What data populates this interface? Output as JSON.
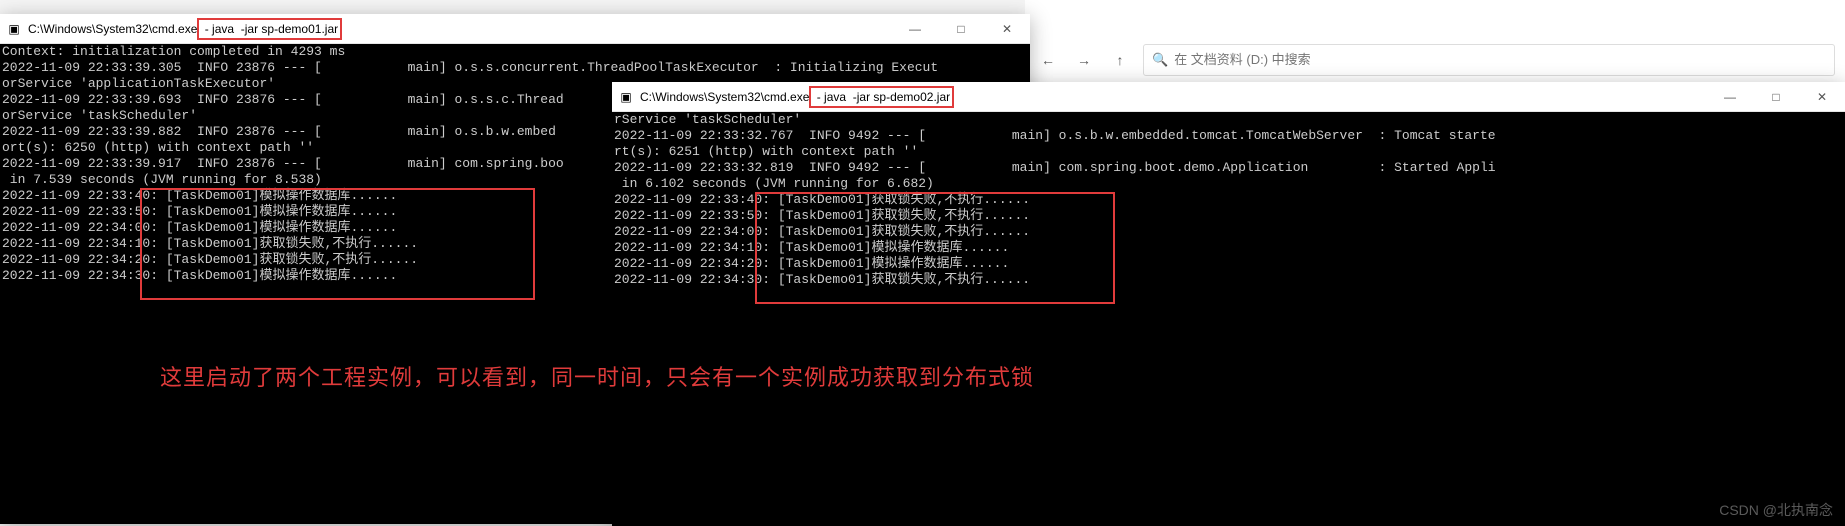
{
  "explorer": {
    "search_placeholder": "在 文档资料 (D:) 中搜索"
  },
  "win1": {
    "title_path": "C:\\Windows\\System32\\cmd.exe",
    "title_cmd": " - java  -jar sp-demo01.jar",
    "lines": [
      "Context: initialization completed in 4293 ms",
      "2022-11-09 22:33:39.305  INFO 23876 --- [           main] o.s.s.concurrent.ThreadPoolTaskExecutor  : Initializing Execut",
      "orService 'applicationTaskExecutor'",
      "2022-11-09 22:33:39.693  INFO 23876 --- [           main] o.s.s.c.Thread",
      "orService 'taskScheduler'",
      "2022-11-09 22:33:39.882  INFO 23876 --- [           main] o.s.b.w.embed",
      "ort(s): 6250 (http) with context path ''",
      "2022-11-09 22:33:39.917  INFO 23876 --- [           main] com.spring.boo",
      " in 7.539 seconds (JVM running for 8.538)"
    ],
    "tasks": [
      "2022-11-09 22:33:40: [TaskDemo01]模拟操作数据库......",
      "2022-11-09 22:33:50: [TaskDemo01]模拟操作数据库......",
      "2022-11-09 22:34:00: [TaskDemo01]模拟操作数据库......",
      "2022-11-09 22:34:10: [TaskDemo01]获取锁失败,不执行......",
      "2022-11-09 22:34:20: [TaskDemo01]获取锁失败,不执行......",
      "2022-11-09 22:34:30: [TaskDemo01]模拟操作数据库......"
    ]
  },
  "win2": {
    "title_path": "C:\\Windows\\System32\\cmd.exe",
    "title_cmd": " - java  -jar sp-demo02.jar",
    "lines": [
      "rService 'taskScheduler'",
      "2022-11-09 22:33:32.767  INFO 9492 --- [           main] o.s.b.w.embedded.tomcat.TomcatWebServer  : Tomcat starte",
      "rt(s): 6251 (http) with context path ''",
      "2022-11-09 22:33:32.819  INFO 9492 --- [           main] com.spring.boot.demo.Application         : Started Appli",
      " in 6.102 seconds (JVM running for 6.682)"
    ],
    "tasks": [
      "2022-11-09 22:33:40: [TaskDemo01]获取锁失败,不执行......",
      "2022-11-09 22:33:50: [TaskDemo01]获取锁失败,不执行......",
      "2022-11-09 22:34:00: [TaskDemo01]获取锁失败,不执行......",
      "2022-11-09 22:34:10: [TaskDemo01]模拟操作数据库......",
      "2022-11-09 22:34:20: [TaskDemo01]模拟操作数据库......",
      "2022-11-09 22:34:30: [TaskDemo01]获取锁失败,不执行......"
    ]
  },
  "annotation": "这里启动了两个工程实例，可以看到，同一时间，只会有一个实例成功获取到分布式锁",
  "watermark": "CSDN @北执南念",
  "colors": {
    "highlight": "#e03b3b",
    "term_fg": "#cccccc",
    "term_bg": "#000000"
  }
}
